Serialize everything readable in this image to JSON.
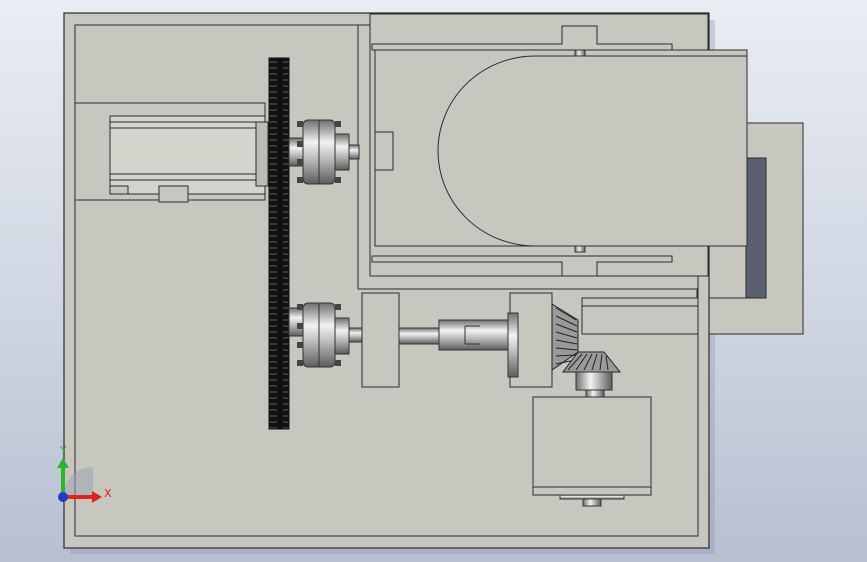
{
  "viewport": {
    "background_top": "#e9edf4",
    "background_bottom": "#b7c0d0"
  },
  "model": {
    "face_color": "#c8c7bf",
    "edge_color": "#2b2b2b",
    "shadow_color": "#8d96a6"
  },
  "triad": {
    "x_label": "X",
    "y_label": "Y",
    "x_color": "#e0241b",
    "y_color": "#2bb52b",
    "origin_color": "#1f3cc8"
  }
}
